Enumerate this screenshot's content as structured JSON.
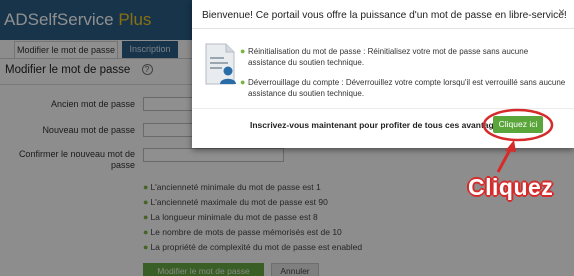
{
  "app": {
    "logo_main": "ADSelfService ",
    "logo_plus": "Plus"
  },
  "tabs": [
    {
      "label": "Modifier le mot de passe",
      "active": true
    },
    {
      "label": "Inscription",
      "active": false
    }
  ],
  "page": {
    "title": "Modifier le mot de passe",
    "help_icon": "?"
  },
  "form": {
    "old_password_label": "Ancien mot de passe",
    "new_password_label": "Nouveau mot de passe",
    "confirm_password_label": "Confirmer le nouveau mot de passe"
  },
  "rules": [
    "L'ancienneté minimale du mot de passe est 1",
    "L'ancienneté maximale du mot de passe est 90",
    "La longueur minimale du mot de passe est 8",
    "Le nombre de mots de passe mémorisés est de 10",
    "La propriété de complexité du mot de passe est enabled"
  ],
  "actions": {
    "submit_label": "Modifier le mot de passe",
    "cancel_label": "Annuler"
  },
  "popup": {
    "title": "Bienvenue! Ce portail vous offre la puissance d'un mot de passe en libre-service!",
    "close_icon": "×",
    "bullets": [
      "Réinitialisation du mot de passe : Réinitialisez votre mot de passe sans aucune assistance du soutien technique.",
      "Déverrouillage du compte : Déverrouillez votre compte lorsqu'il est verrouillé sans aucune assistance du soutien technique."
    ],
    "cta_text": "Inscrivez-vous maintenant pour profiter de tous ces avantages!",
    "cta_button": "Cliquez ici"
  },
  "annotation": {
    "label": "Cliquez",
    "color": "#d62b2b"
  },
  "colors": {
    "header": "#2a5d86",
    "accent_green": "#5aa63a",
    "logo_plus": "#f2c61f"
  }
}
